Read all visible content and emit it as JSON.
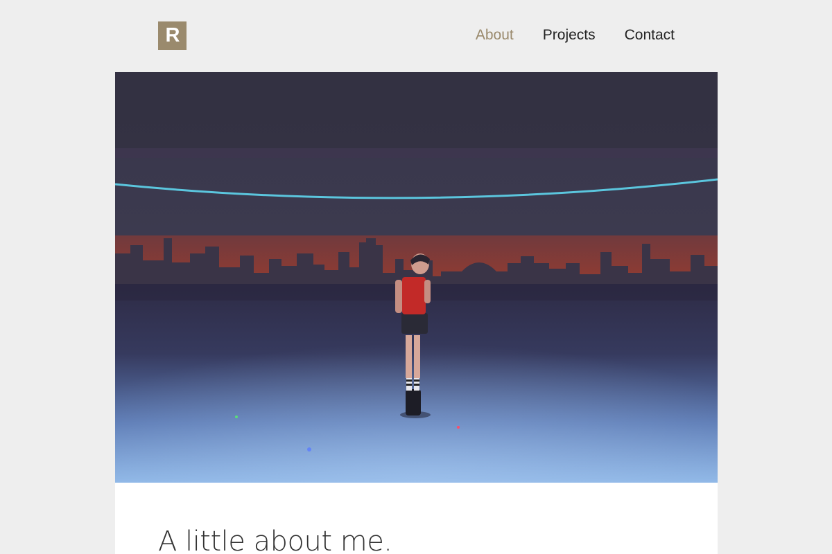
{
  "brand": {
    "logo_letter": "R",
    "logo_color": "#9a8a6d"
  },
  "nav": {
    "items": [
      {
        "label": "About",
        "active": true
      },
      {
        "label": "Projects",
        "active": false
      },
      {
        "label": "Contact",
        "active": false
      }
    ],
    "active_color": "#9a8a6d"
  },
  "hero": {
    "image_subject": "photo"
  },
  "main": {
    "heading": "A little about me."
  }
}
